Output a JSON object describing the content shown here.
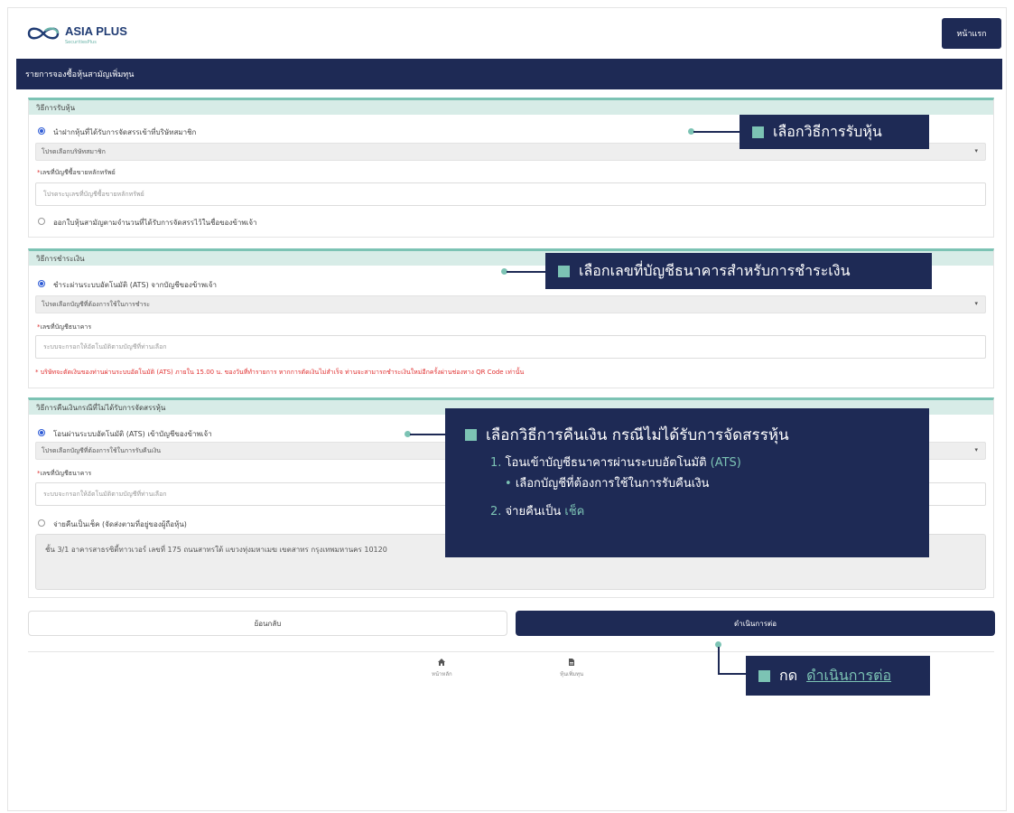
{
  "header": {
    "logo_text": "ASIA PLUS",
    "logo_sub": "SecuritiesPlus",
    "home_button": "หน้าแรก"
  },
  "topbar": {
    "title": "รายการจองซื้อหุ้นสามัญเพิ่มทุน"
  },
  "section_receive": {
    "title": "วิธีการรับหุ้น",
    "option1": "นำฝากหุ้นที่ได้รับการจัดสรรเข้าที่บริษัทสมาชิก",
    "select_placeholder": "โปรดเลือกบริษัทสมาชิก",
    "field_label": "เลขที่บัญชีซื้อขายหลักทรัพย์",
    "field_placeholder": "โปรดระบุเลขที่บัญชีซื้อขายหลักทรัพย์",
    "option2": "ออกใบหุ้นสามัญตามจำนวนที่ได้รับการจัดสรรไว้ในชื่อของข้าพเจ้า"
  },
  "section_payment": {
    "title": "วิธีการชำระเงิน",
    "option1": "ชำระผ่านระบบอัตโนมัติ (ATS) จากบัญชีของข้าพเจ้า",
    "select_placeholder": "โปรดเลือกบัญชีที่ต้องการใช้ในการชำระ",
    "field_label": "เลขที่บัญชีธนาคาร",
    "field_placeholder": "ระบบจะกรอกให้อัตโนมัติตามบัญชีที่ท่านเลือก",
    "warning": "บริษัทจะตัดเงินของท่านผ่านระบบอัตโนมัติ (ATS) ภายใน 15.00 น. ของวันที่ทำรายการ หากการตัดเงินไม่สำเร็จ ท่านจะสามารถชำระเงินใหม่อีกครั้งผ่านช่องทาง QR Code เท่านั้น"
  },
  "section_refund": {
    "title": "วิธีการคืนเงินกรณีที่ไม่ได้รับการจัดสรรหุ้น",
    "option1": "โอนผ่านระบบอัตโนมัติ (ATS) เข้าบัญชีของข้าพเจ้า",
    "select_placeholder": "โปรดเลือกบัญชีที่ต้องการใช้ในการรับคืนเงิน",
    "field_label": "เลขที่บัญชีธนาคาร",
    "field_placeholder": "ระบบจะกรอกให้อัตโนมัติตามบัญชีที่ท่านเลือก",
    "option2": "จ่ายคืนเป็นเช็ค (จัดส่งตามที่อยู่ของผู้ถือหุ้น)",
    "address": "ชั้น 3/1 อาคารสาธรซิตี้ทาวเวอร์ เลขที่ 175 ถนนสาทรใต้ แขวงทุ่งมหาเมฆ เขตสาทร กรุงเทพมหานคร 10120"
  },
  "buttons": {
    "back": "ย้อนกลับ",
    "next": "ดำเนินการต่อ"
  },
  "footer_nav": [
    {
      "label": "หน้าหลัก",
      "icon": "home-icon"
    },
    {
      "label": "หุ้นเพิ่มทุน",
      "icon": "document-icon"
    }
  ],
  "callouts": {
    "c1": "เลือกวิธีการรับหุ้น",
    "c2": "เลือกเลขที่บัญชีธนาคารสำหรับการชำระเงิน",
    "c3_title": "เลือกวิธีการคืนเงิน กรณีไม่ได้รับการจัดสรรหุ้น",
    "c3_item1_num": "1.",
    "c3_item1_text": "โอนเข้าบัญชีธนาคารผ่านระบบอัตโนมัติ",
    "c3_item1_acc": "(ATS)",
    "c3_item1_sub": "เลือกบัญชีที่ต้องการใช้ในการรับคืนเงิน",
    "c3_item2_num": "2.",
    "c3_item2_text": "จ่ายคืนเป็น",
    "c3_item2_acc": "เช็ค",
    "c4_prefix": "กด",
    "c4_link": "ดำเนินการต่อ"
  },
  "colors": {
    "navy": "#1e2a55",
    "teal": "#7cc3b4",
    "warning_red": "#e03131",
    "radio_blue": "#2f5cd6"
  }
}
